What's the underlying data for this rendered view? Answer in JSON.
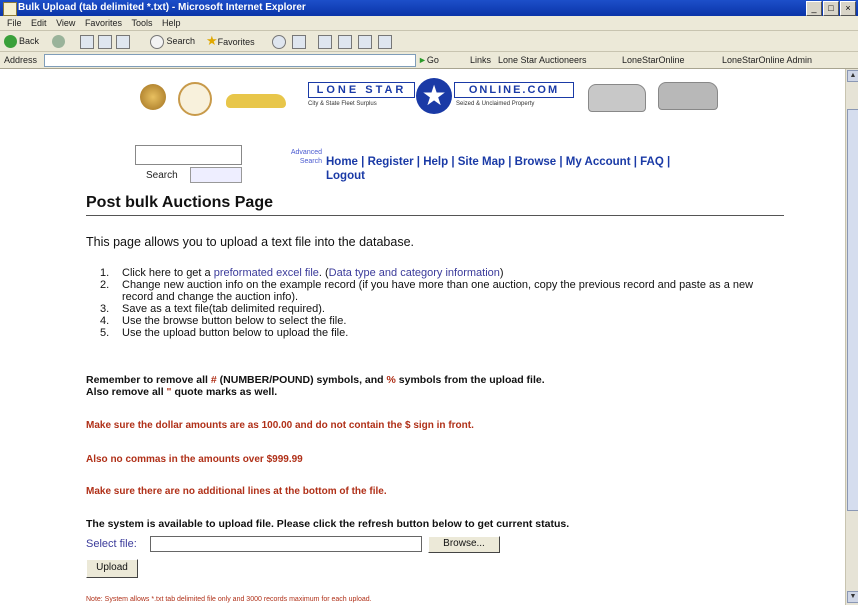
{
  "window": {
    "title": "Bulk Upload (tab delimited *.txt) - Microsoft Internet Explorer",
    "buttons": [
      "_",
      "□",
      "×"
    ]
  },
  "menu": [
    "File",
    "Edit",
    "View",
    "Favorites",
    "Tools",
    "Help"
  ],
  "toolbar": {
    "back": "Back",
    "search": "Search",
    "favorites": "Favorites"
  },
  "addressbar": {
    "label": "Address",
    "go": "Go",
    "links": "Links",
    "link1": "Lone Star Auctioneers",
    "link2": "LoneStarOnline",
    "link3": "LoneStarOnline Admin"
  },
  "logo": {
    "left": "LONE STAR",
    "right": "ONLINE.COM",
    "left_sub": "City & State Fleet Surplus",
    "right_sub": "Seized & Unclaimed Property"
  },
  "search": {
    "label": "Search",
    "advanced_line1": "Advanced",
    "advanced_line2": "Search"
  },
  "nav": {
    "home": "Home",
    "register": "Register",
    "help": "Help",
    "sitemap": "Site Map",
    "browse": "Browse",
    "my_account": "My Account",
    "faq": "FAQ",
    "logout": "Logout",
    "sep": " | "
  },
  "page": {
    "title": "Post bulk Auctions Page",
    "intro": "This page allows you to upload a text file into the database.",
    "steps": [
      {
        "num": "1.",
        "text_pre": "Click here to get a ",
        "link1": "preformated excel file",
        "mid": ". (",
        "link2": "Data type and category information",
        "post": ")"
      },
      {
        "num": "2.",
        "text": "Change new auction info on the example record (if you have more than one auction, copy the previous record and paste as a new record and change the auction info)."
      },
      {
        "num": "3.",
        "text": "Save as a text file(tab delimited required)."
      },
      {
        "num": "4.",
        "text": "Use the browse button below to select the file."
      },
      {
        "num": "5.",
        "text": "Use the upload button below to upload the file."
      }
    ],
    "remember_pre": "Remember to remove all ",
    "hash": "#",
    "remember_mid": " (NUMBER/POUND) symbols, and ",
    "percent": "%",
    "remember_post": " symbols from the upload file.",
    "remember_line2_pre": "Also remove all ",
    "quote": "\"",
    "remember_line2_post": " quote marks as well.",
    "warn1": "Make sure the dollar amounts are as 100.00 and do not contain the $ sign in front.",
    "warn2": "Also no commas in the amounts over $999.99",
    "warn3": "Make sure there are no additional lines at the bottom of the file.",
    "status": "The system is available to upload file. Please click the refresh button below to get current status.",
    "select_label": "Select file:",
    "browse_btn": "Browse...",
    "upload_btn": "Upload",
    "note": "Note:  System allows *.txt tab delimited file only and 3000 records maximum for each upload."
  }
}
